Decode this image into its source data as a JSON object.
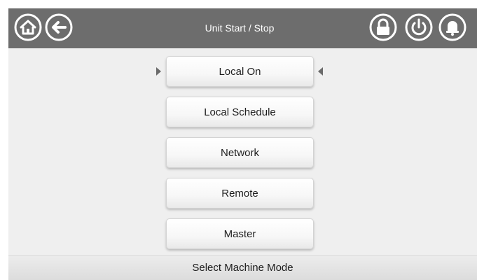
{
  "header": {
    "title": "Unit Start / Stop",
    "left_icons": [
      "home-icon",
      "back-arrow-icon"
    ],
    "right_icons": [
      "lock-icon",
      "power-icon",
      "alarm-bell-icon"
    ]
  },
  "modes": {
    "selected": "Local On",
    "items": [
      {
        "label": "Local On"
      },
      {
        "label": "Local Schedule"
      },
      {
        "label": "Network"
      },
      {
        "label": "Remote"
      },
      {
        "label": "Master"
      }
    ]
  },
  "footer": {
    "text": "Select Machine Mode"
  },
  "colors": {
    "header_bg": "#6d6d6d",
    "screen_bg": "#efefef",
    "icon_white": "#ffffff"
  }
}
